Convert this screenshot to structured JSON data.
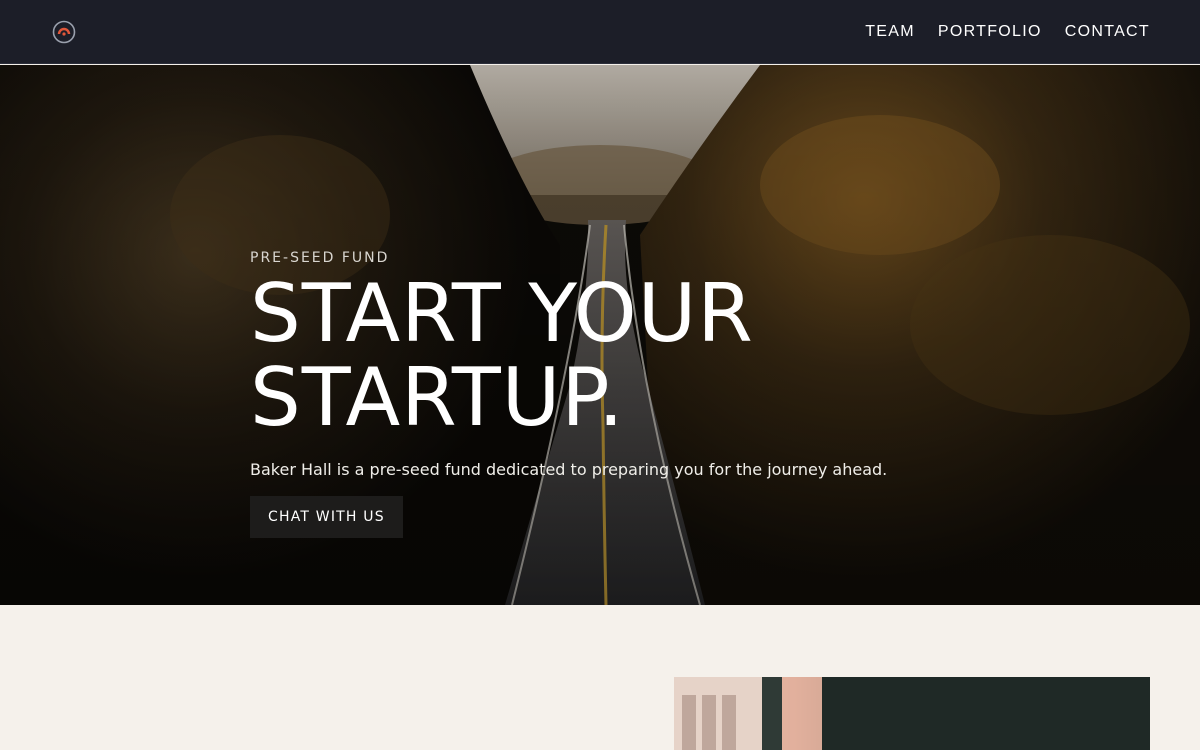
{
  "nav": {
    "logo_icon": "gauge-logo-icon",
    "links": [
      {
        "label": "TEAM"
      },
      {
        "label": "PORTFOLIO"
      },
      {
        "label": "CONTACT"
      }
    ]
  },
  "hero": {
    "eyebrow": "PRE-SEED FUND",
    "headline_line1": "START YOUR",
    "headline_line2": "STARTUP.",
    "subtext": "Baker Hall is a pre-seed fund dedicated to preparing you for the journey ahead.",
    "cta_label": "CHAT WITH US",
    "image": "road-through-autumn-forest"
  },
  "lower_section": {
    "image": "building-at-dusk"
  },
  "colors": {
    "nav_bg": "#1c1e28",
    "page_bg": "#f5f1eb",
    "cta_bg": "#1d1c1b",
    "logo_accent": "#e0573a"
  }
}
